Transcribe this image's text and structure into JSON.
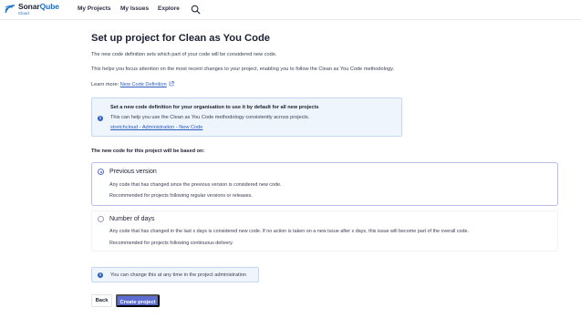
{
  "nav": {
    "logo_sonar": "Sonar",
    "logo_qube": "Qube",
    "logo_cloud": "Cloud",
    "items": [
      "My Projects",
      "My Issues",
      "Explore"
    ]
  },
  "page": {
    "title": "Set up project for Clean as You Code",
    "intro1": "The new code definition sets which part of your code will be considered new code.",
    "intro2": "This helps you focus attention on the most recent changes to your project, enabling you to follow the Clean as You Code methodology.",
    "learn_more_label": "Learn more:",
    "learn_more_link": "New Code Definition"
  },
  "info_box": {
    "title": "Set a new code definition for your organisation to use it by default for all new projects",
    "text": "This can help you use the Clean as You Code methodology consistently across projects.",
    "link": "stretchcloud - Administration - New Code"
  },
  "options_label": "The new code for this project will be based on:",
  "options": [
    {
      "title": "Previous version",
      "line1": "Any code that has changed since the previous version is considered new code.",
      "line2": "Recommended for projects following regular versions or releases.",
      "selected": true
    },
    {
      "title": "Number of days",
      "line1": "Any code that has changed in the last x days is considered new code. If no action is taken on a new issue after x days, this issue will become part of the overall code.",
      "line2": "Recommended for projects following continuous delivery.",
      "selected": false
    }
  ],
  "note": "You can change this at any time in the project administration",
  "buttons": {
    "back": "Back",
    "create": "Create project"
  },
  "colors": {
    "accent": "#5d6cd0",
    "link": "#2b5dbf",
    "info_bg": "#eff5fc"
  },
  "icons": {
    "search": "search-icon",
    "external": "external-link-icon",
    "info": "info-icon",
    "logo": "sonarqube-logo-icon"
  }
}
